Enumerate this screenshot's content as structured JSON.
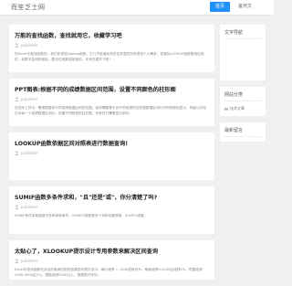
{
  "site": {
    "logo": "而笙乏士网"
  },
  "nav": {
    "items": [
      {
        "label": "首页",
        "active": true
      },
      {
        "label": "备用文"
      }
    ]
  },
  "articles": [
    {
      "title": "万能的查找函数，查找就用它，收藏学习吧",
      "author": "publisher",
      "excerpt": "在Excel中查找函数的，我们也带您Lookup函数，它几乎能满足您在实务里的所有查找个人需求，说查找LOOKUP函数基础应用的，如果不会用的朋友，要记住函数返回相关，本来在建学习吧！...",
      "tag": "查找函数",
      "more": "阅读全文"
    },
    {
      "title": "PPT图表:根据不同的成绩数据区间范围，设置不同颜色的柱形图",
      "author": "publisher",
      "excerpt": "在实际工作中，需根据要求不同成绩数据区间的范围，如何需要基于对不同成绩的柱形图数据区间分不同的颜色显示，例如以对空白对每一个成绩数据区间分，设置不同颜色的柱形图，也有时只需要显示即可。",
      "tag": "图表",
      "more": "阅读全文"
    },
    {
      "title": "LOOKUP函数依据区间对照表进行数据查询!",
      "author": "publisher",
      "excerpt": "",
      "tag": "LOOKUP",
      "more": "阅读全文"
    },
    {
      "title": "SUMIF函数多条件求和，\"且\"还是\"或\"，你分清楚了吗?",
      "author": "publisher",
      "excerpt": "SUMIF条件求和函数可多种求和条件，SUMIFS函数是多个求和也最简单，SUMIFS函数...",
      "tag": "SUMIF",
      "more": "阅读全文"
    },
    {
      "title": "太贴心了，XLOOKUP提示设计专用参数来解决区间查询",
      "author": "publisher",
      "excerpt": "Excel中查找函数在对应的查询匹配的结果的处理方法中，单价成绩 = 1000成就可为：等级成绩0-2000区成绩1%，根据成绩2000-5000区2%，根据成绩5000以上，根据提升完毕。",
      "tag": "",
      "more": ""
    }
  ],
  "sidebar": {
    "widgets": [
      {
        "title": "文字导航",
        "items": []
      },
      {
        "title": "网站分类",
        "items": [
          "技术文章"
        ]
      },
      {
        "title": "最新留言",
        "items": []
      }
    ]
  },
  "colors": {
    "accent": "#1e90ff",
    "background": "#f0f0f0"
  }
}
